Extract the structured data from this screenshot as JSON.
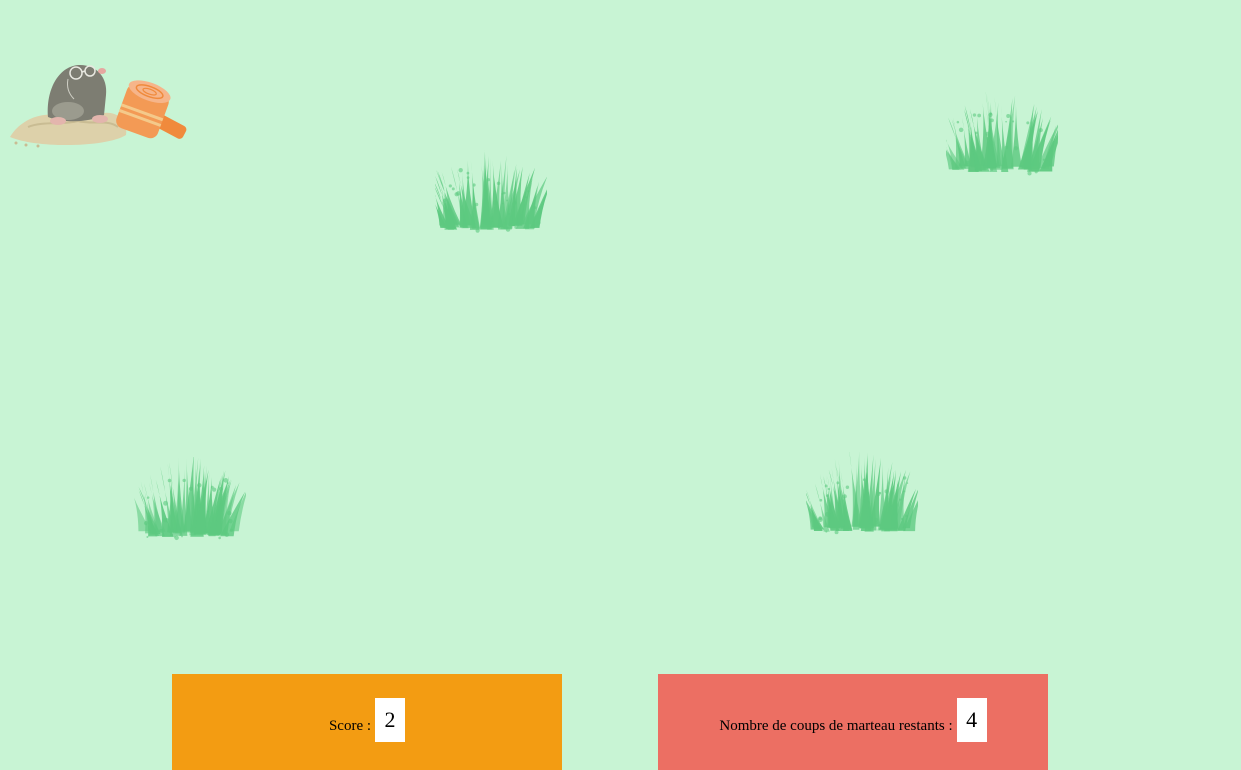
{
  "colors": {
    "background": "#c8f4d4",
    "score_panel": "#f39c12",
    "hammer_panel": "#ec6f63",
    "bush": "#5dc980",
    "mole": "#7d7d72",
    "mound": "#ddd1aa",
    "hammer": "#f08a3c"
  },
  "logo": {
    "icon": "mole-hammer-logo-icon"
  },
  "bushes": [
    {
      "icon": "bush-icon"
    },
    {
      "icon": "bush-icon"
    },
    {
      "icon": "bush-icon"
    },
    {
      "icon": "bush-icon"
    }
  ],
  "score": {
    "label": "Score :",
    "value": "2"
  },
  "hammers": {
    "label": "Nombre de coups de marteau restants :",
    "value": "4"
  }
}
